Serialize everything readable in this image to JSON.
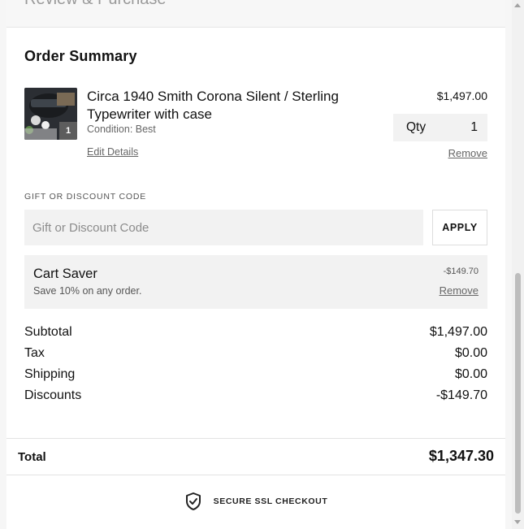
{
  "header": {
    "clipped_title": "Review & Purchase"
  },
  "order_summary": {
    "title": "Order Summary",
    "item": {
      "name": "Circa 1940 Smith Corona Silent / Sterling Typewriter with case",
      "condition": "Condition: Best",
      "edit_label": "Edit Details",
      "price": "$1,497.00",
      "qty_label": "Qty",
      "qty_value": "1",
      "badge_qty": "1",
      "remove_label": "Remove"
    }
  },
  "discount": {
    "label": "GIFT OR DISCOUNT CODE",
    "placeholder": "Gift or Discount Code",
    "apply_label": "APPLY",
    "applied": {
      "name": "Cart Saver",
      "description": "Save 10% on any order.",
      "amount": "-$149.70",
      "remove_label": "Remove"
    }
  },
  "totals": {
    "rows": [
      {
        "label": "Subtotal",
        "value": "$1,497.00"
      },
      {
        "label": "Tax",
        "value": "$0.00"
      },
      {
        "label": "Shipping",
        "value": "$0.00"
      },
      {
        "label": "Discounts",
        "value": "-$149.70"
      }
    ],
    "total_label": "Total",
    "total_value": "$1,347.30"
  },
  "footer": {
    "secure_text": "SECURE SSL CHECKOUT",
    "icon": "shield-check-icon"
  }
}
